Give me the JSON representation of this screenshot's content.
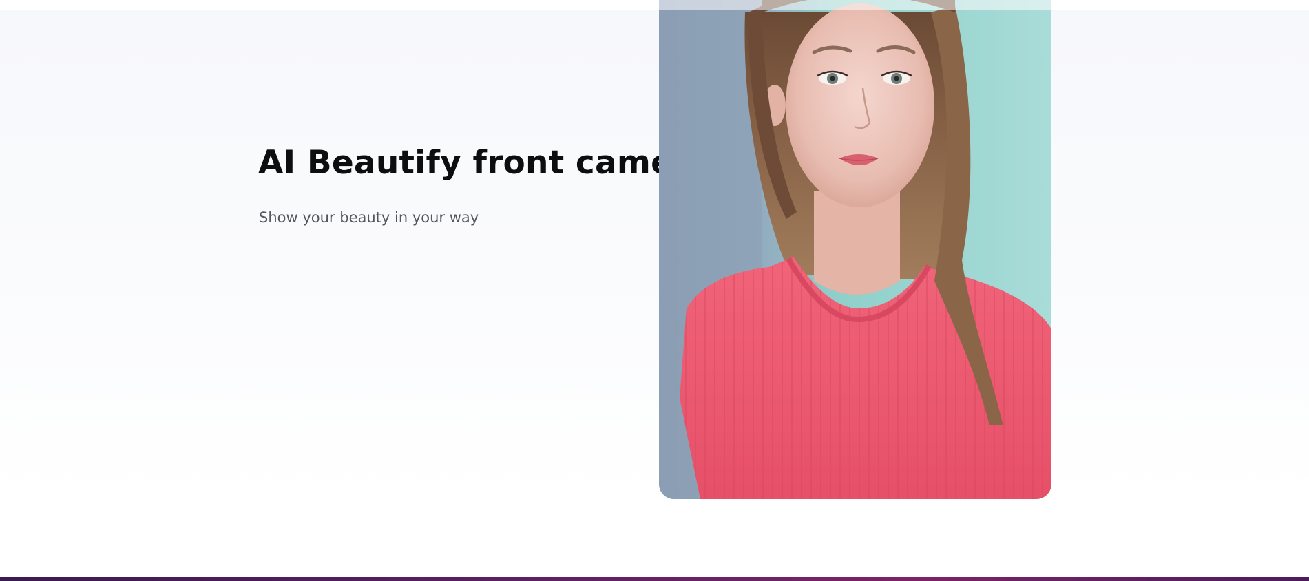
{
  "feature": {
    "headline": "AI Beautify front camera",
    "subline": "Show your beauty in your way"
  },
  "photo": {
    "subject": "selfie-portrait-photo"
  },
  "colors": {
    "headline": "#0e0e10",
    "subline": "#54565c",
    "shirt": "#ee5a72",
    "bottom_bar": "#5d1f63"
  }
}
